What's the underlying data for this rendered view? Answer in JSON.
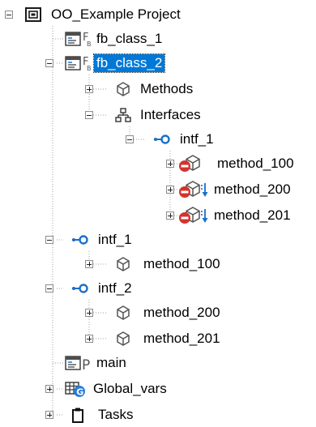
{
  "tree": {
    "root": {
      "label": "OO_Example Project"
    },
    "fb_class_1": {
      "label": "fb_class_1"
    },
    "fb_class_2": {
      "label": "fb_class_2"
    },
    "methods": {
      "label": "Methods"
    },
    "interfaces": {
      "label": "Interfaces"
    },
    "intf_1_nested": {
      "label": "intf_1"
    },
    "method_100_nested": {
      "label": "method_100"
    },
    "method_200_nested": {
      "label": "method_200"
    },
    "method_201_nested": {
      "label": "method_201"
    },
    "intf_1": {
      "label": "intf_1"
    },
    "method_100": {
      "label": "method_100"
    },
    "intf_2": {
      "label": "intf_2"
    },
    "method_200": {
      "label": "method_200"
    },
    "method_201": {
      "label": "method_201"
    },
    "main": {
      "label": "main"
    },
    "global_vars": {
      "label": "Global_vars"
    },
    "tasks": {
      "label": "Tasks"
    }
  },
  "colors": {
    "selection": "#0078d7",
    "interface_blue": "#1a6fc9",
    "forbidden_red": "#d4342c",
    "global_blue": "#2b7fd6"
  }
}
